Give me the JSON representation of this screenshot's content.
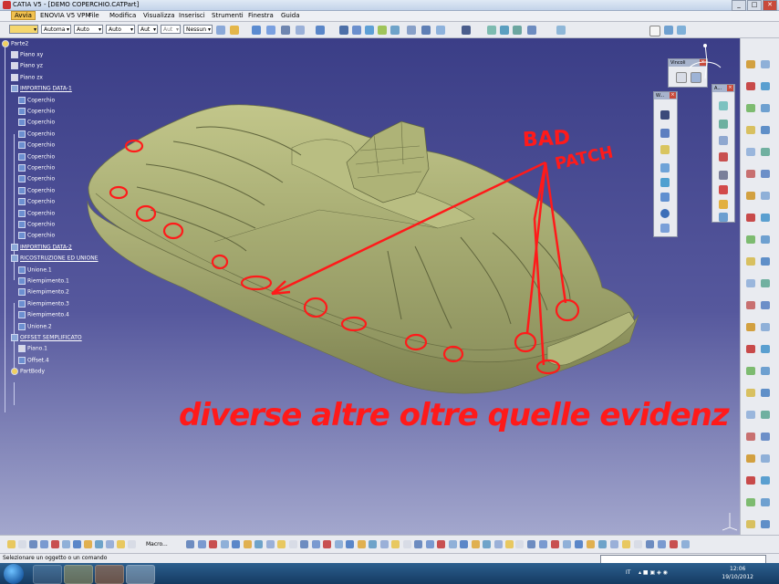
{
  "window": {
    "title": "CATIA V5 - [DEMO COPERCHIO.CATPart]",
    "controls": [
      "_",
      "□",
      "✕"
    ]
  },
  "menu": [
    "Avvia",
    "ENOVIA V5 VPM",
    "File",
    "Modifica",
    "Visualizza",
    "Inserisci",
    "Strumenti",
    "Finestra",
    "Guida"
  ],
  "toolbar": {
    "dropdowns": [
      "",
      "Automa",
      "Auto",
      "Auto",
      "Aut",
      "Aut",
      "Nessun"
    ]
  },
  "tree": {
    "root": "Parte2",
    "items": [
      {
        "label": "Piano xy",
        "icon": "plane"
      },
      {
        "label": "Piano yz",
        "icon": "plane"
      },
      {
        "label": "Piano zx",
        "icon": "plane"
      },
      {
        "label": "IMPORTING DATA-1",
        "icon": "set"
      },
      {
        "label": "Coperchio",
        "icon": "geo"
      },
      {
        "label": "Coperchio",
        "icon": "geo"
      },
      {
        "label": "Coperchio",
        "icon": "geo"
      },
      {
        "label": "Coperchio",
        "icon": "geo"
      },
      {
        "label": "Coperchio",
        "icon": "geo"
      },
      {
        "label": "Coperchio",
        "icon": "geo"
      },
      {
        "label": "Coperchio",
        "icon": "geo"
      },
      {
        "label": "Coperchio",
        "icon": "geo"
      },
      {
        "label": "Coperchio",
        "icon": "geo"
      },
      {
        "label": "Coperchio",
        "icon": "geo"
      },
      {
        "label": "Coperchio",
        "icon": "geo"
      },
      {
        "label": "Coperchio",
        "icon": "geo"
      },
      {
        "label": "Coperchio",
        "icon": "geo"
      },
      {
        "label": "IMPORTING DATA-2",
        "icon": "set"
      },
      {
        "label": "RICOSTRUZIONE ED UNIONE",
        "icon": "set"
      },
      {
        "label": "Unione.1",
        "icon": "geo"
      },
      {
        "label": "Riempimento.1",
        "icon": "geo"
      },
      {
        "label": "Riempimento.2",
        "icon": "geo"
      },
      {
        "label": "Riempimento.3",
        "icon": "geo"
      },
      {
        "label": "Riempimento.4",
        "icon": "geo"
      },
      {
        "label": "Unione.2",
        "icon": "geo"
      },
      {
        "label": "OFFSET SEMPLIFICATO",
        "icon": "set"
      },
      {
        "label": "Piano.1",
        "icon": "plane"
      },
      {
        "label": "Offset.4",
        "icon": "geo"
      },
      {
        "label": "PartBody",
        "icon": "body"
      }
    ]
  },
  "panels": {
    "vincoli": "Vincoli",
    "w": "W...",
    "a": "A..."
  },
  "annotations": {
    "bad": "BAD",
    "patch": "PATCH",
    "note": "diverse altre oltre quelle evidenz"
  },
  "bottom_toolbar": {
    "macro_label": "Macro..."
  },
  "status": {
    "message": "Selezionare un oggetto o un comando"
  },
  "taskbar": {
    "language": "IT",
    "time": "12:06",
    "date": "19/10/2012"
  },
  "colors": {
    "viewport_top": "#3b3e87",
    "model_surface": "#a6ab72",
    "annotation_red": "#ff1a1a",
    "active_menu": "#f2c14e"
  }
}
